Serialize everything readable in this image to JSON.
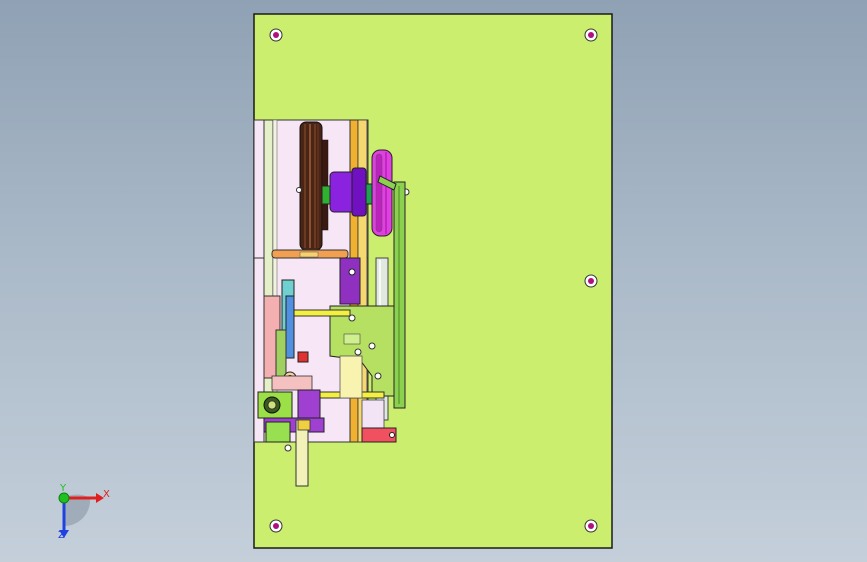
{
  "viewport": {
    "background_top": "#8fa1b4",
    "background_bottom": "#c4cfda"
  },
  "model": {
    "base_plate_color": "#ccee6e",
    "mechanism_panel_color": "#f7e6f6",
    "pulley_color": "#5a2e1c",
    "handwheel_color": "#e040e0",
    "motor_color": "#8b22e0",
    "bracket_color": "#b6e062",
    "rail_color": "#f0b030",
    "rod_color": "#f4f040",
    "mount_hole_color": "#b0107a"
  },
  "triad": {
    "x_label": "X",
    "y_label": "Y",
    "z_label": "Z",
    "x_color": "#e02020",
    "y_color": "#20c020",
    "z_color": "#2040e0"
  }
}
